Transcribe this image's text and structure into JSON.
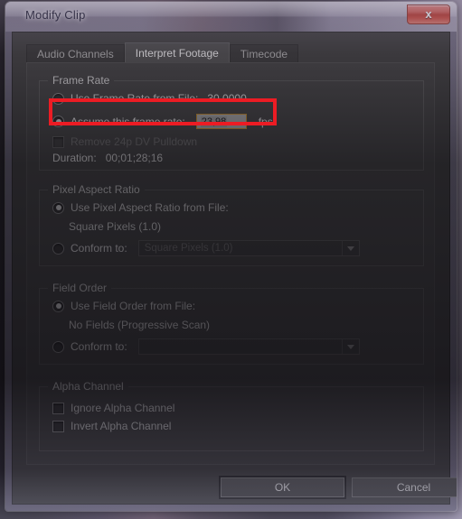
{
  "window": {
    "title": "Modify Clip",
    "close_label": "x",
    "close_icon": "close-icon"
  },
  "tabs": [
    {
      "label": "Audio Channels",
      "active": false
    },
    {
      "label": "Interpret Footage",
      "active": true
    },
    {
      "label": "Timecode",
      "active": false
    }
  ],
  "frame_rate": {
    "legend": "Frame Rate",
    "use_from_file_label": "Use Frame Rate from File:",
    "use_from_file_value": "30.0000",
    "use_from_file_selected": false,
    "assume_label": "Assume this frame rate:",
    "assume_selected": true,
    "assume_value": "23,98",
    "unit": "fps",
    "pulldown_label": "Remove 24p DV Pulldown",
    "pulldown_checked": false,
    "duration_label": "Duration:",
    "duration_value": "00;01;28;16"
  },
  "pixel_aspect_ratio": {
    "legend": "Pixel Aspect Ratio",
    "use_from_file_label": "Use Pixel Aspect Ratio from File:",
    "use_from_file_selected": true,
    "file_value": "Square Pixels (1.0)",
    "conform_label": "Conform to:",
    "conform_selected": false,
    "conform_value": "Square Pixels (1.0)"
  },
  "field_order": {
    "legend": "Field Order",
    "use_from_file_label": "Use Field Order from File:",
    "use_from_file_selected": true,
    "file_value": "No Fields (Progressive Scan)",
    "conform_label": "Conform to:",
    "conform_selected": false,
    "conform_value": ""
  },
  "alpha_channel": {
    "legend": "Alpha Channel",
    "ignore_label": "Ignore Alpha Channel",
    "ignore_checked": false,
    "invert_label": "Invert Alpha Channel",
    "invert_checked": false
  },
  "buttons": {
    "ok": "OK",
    "cancel": "Cancel"
  },
  "annotation": {
    "highlight_color": "#ec1c24",
    "target": "Assume this frame rate row"
  },
  "colors": {
    "panel_bg": "#3f3f3f",
    "dialog_bg": "#3b3b3b",
    "accent_input_border": "#c08a2a",
    "highlight_red": "#ec1c24",
    "text_primary": "#d2d2d2",
    "text_disabled": "#6e6e6e"
  }
}
